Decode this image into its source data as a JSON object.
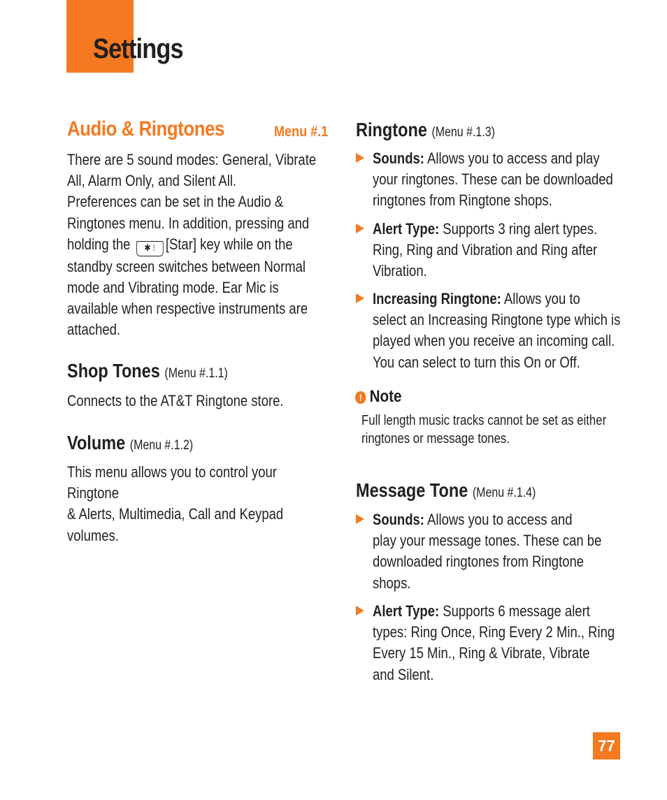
{
  "page": {
    "title": "Settings",
    "number": "77",
    "accent_color": "#f47920"
  },
  "audio": {
    "heading": "Audio & Ringtones",
    "menu_ref": "Menu #.1",
    "lines": [
      "There are 5 sound modes: General, Vibrate",
      "All, Alarm Only, and Silent All.",
      "Preferences can be set in the Audio &",
      "Ringtones menu. In addition, pressing and"
    ],
    "holding_before": "holding the",
    "star_key_icon": "star-key-icon",
    "holding_after": "[Star] key while on the",
    "lines2": [
      "standby screen switches between Normal",
      "mode and Vibrating mode. Ear Mic is",
      "available when respective instruments are",
      "attached."
    ]
  },
  "shop_tones": {
    "heading": "Shop Tones",
    "ref": "(Menu #.1.1)",
    "text": "Connects to the AT&T Ringtone store."
  },
  "volume": {
    "heading": "Volume",
    "ref": "(Menu #.1.2)",
    "lines": [
      "This menu allows you to control your Ringtone",
      "& Alerts, Multimedia, Call and Keypad",
      "volumes."
    ]
  },
  "ringtone": {
    "heading": "Ringtone",
    "ref": "(Menu #.1.3)",
    "bullets": [
      {
        "label": "Sounds:",
        "lines": [
          " Allows you to access and play",
          "your ringtones. These can be downloaded",
          "ringtones from Ringtone shops."
        ]
      },
      {
        "label": "Alert Type:",
        "lines": [
          " Supports 3 ring alert types.",
          "Ring, Ring and Vibration and Ring after",
          "Vibration."
        ]
      },
      {
        "label": "Increasing Ringtone:",
        "lines": [
          " Allows you to",
          "select an Increasing Ringtone type which is",
          "played when you receive an incoming call.",
          "You can select to turn this On or Off."
        ]
      }
    ]
  },
  "note": {
    "icon": "!",
    "heading": "Note",
    "lines": [
      "Full length music tracks cannot be set as either",
      "ringtones or message tones."
    ]
  },
  "message_tone": {
    "heading": "Message Tone",
    "ref": "(Menu #.1.4)",
    "bullets": [
      {
        "label": "Sounds:",
        "lines": [
          " Allows you to access and",
          "play your message tones. These can be",
          "downloaded ringtones from Ringtone",
          "shops."
        ]
      },
      {
        "label": "Alert Type:",
        "lines": [
          " Supports 6 message alert",
          "types: Ring Once, Ring Every 2 Min., Ring",
          "Every 15 Min., Ring & Vibrate, Vibrate",
          "and Silent."
        ]
      }
    ]
  }
}
